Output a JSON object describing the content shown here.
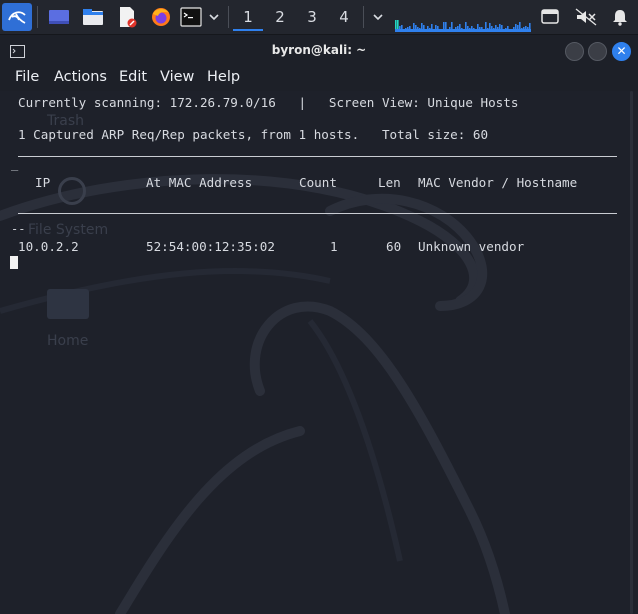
{
  "panel": {
    "workspaces": [
      "1",
      "2",
      "3",
      "4"
    ],
    "active_workspace": "1",
    "icons": [
      "kali-menu-icon",
      "show-desktop-icon",
      "file-manager-icon",
      "text-editor-icon",
      "firefox-icon",
      "terminal-icon",
      "chevron-down-icon",
      "screenshot-icon",
      "volume-muted-icon",
      "bell-icon"
    ]
  },
  "window": {
    "title": "byron@kali: ~",
    "menu": [
      "File",
      "Actions",
      "Edit",
      "View",
      "Help"
    ]
  },
  "desktop_ghosts": {
    "trash": "Trash",
    "filesystem": "File System",
    "home": "Home"
  },
  "terminal": {
    "line1": "Currently scanning: 172.26.79.0/16   |   Screen View: Unique Hosts",
    "line2": "1 Captured ARP Req/Rep packets, from 1 hosts.   Total size: 60",
    "dash_top": "_",
    "dash_bottom": "--",
    "headers": {
      "ip": "IP",
      "mac": "At MAC Address",
      "count": "Count",
      "len": "Len",
      "vendor": "MAC Vendor / Hostname"
    },
    "rows": [
      {
        "ip": "10.0.2.2",
        "mac": "52:54:00:12:35:02",
        "count": "1",
        "len": "60",
        "vendor": "Unknown vendor"
      }
    ]
  },
  "colors": {
    "accent": "#2f80ed",
    "panel_bg": "#23262e",
    "terminal_bg": "#1e212a",
    "text": "#d7dae0"
  }
}
